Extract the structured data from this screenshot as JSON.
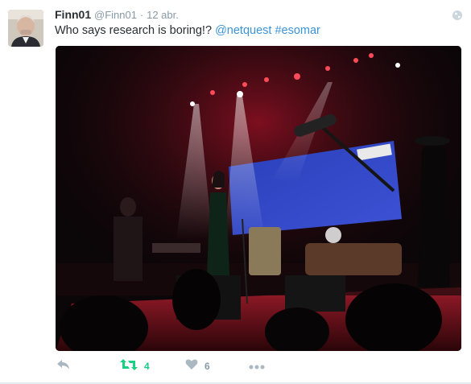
{
  "tweet": {
    "name": "Finn01",
    "handle": "@Finn01",
    "separator": "·",
    "date": "12 abr.",
    "text_plain": "Who says research is boring!? ",
    "mention": "@netquest",
    "hashtag": "#esomar",
    "icon_globe": "globe-icon"
  },
  "actions": {
    "reply_icon": "reply-icon",
    "retweet_icon": "retweet-icon",
    "retweet_count": "4",
    "retweet_color": "#19cf86",
    "like_icon": "heart-icon",
    "like_count": "6",
    "more_icon": "more-icon"
  },
  "colors": {
    "link": "#3b94d9",
    "muted": "#8899a6",
    "text": "#292f33"
  }
}
